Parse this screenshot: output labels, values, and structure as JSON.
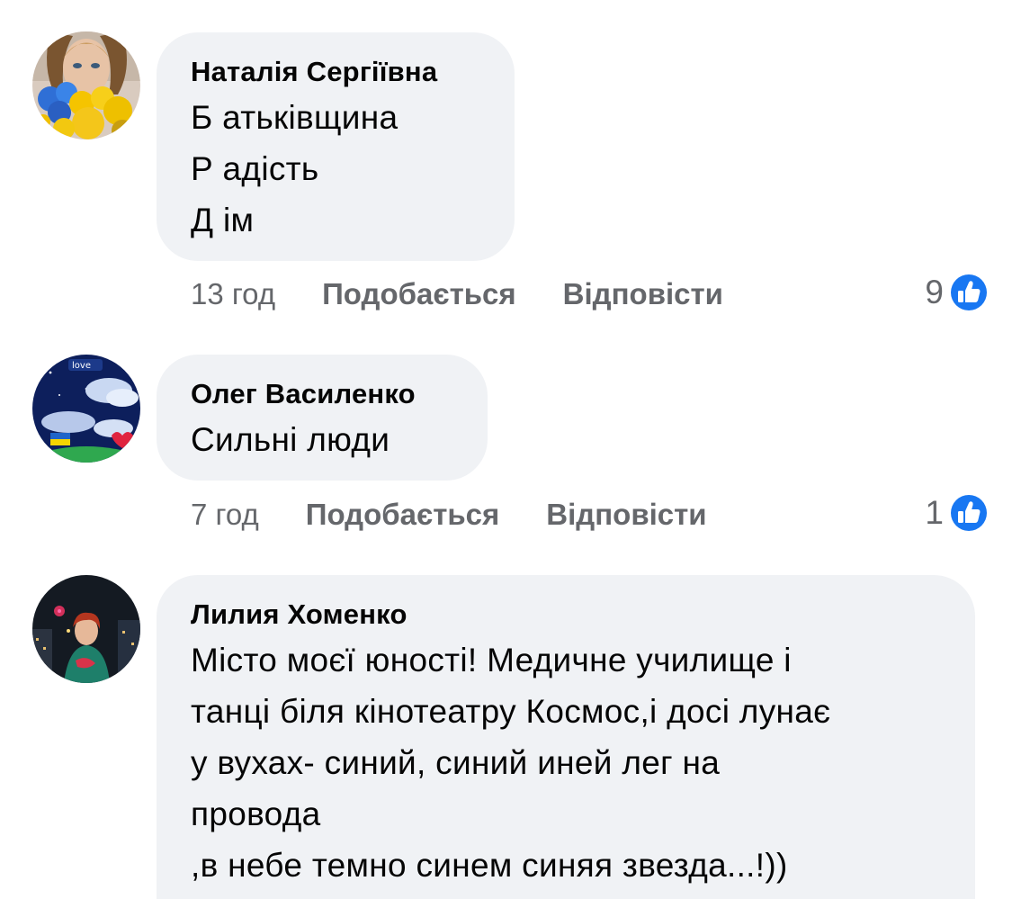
{
  "comments": [
    {
      "author": "Наталія Сергіївна",
      "lines": [
        "Б атьківщина",
        "Р адість",
        "Д ім"
      ],
      "time": "13 год",
      "like_label": "Подобається",
      "reply_label": "Відповісти",
      "reaction_count": "9"
    },
    {
      "author": "Олег Василенко",
      "lines": [
        "Сильні люди"
      ],
      "time": "7 год",
      "like_label": "Подобається",
      "reply_label": "Відповісти",
      "reaction_count": "1"
    },
    {
      "author": "Лилия Хоменко",
      "lines": [
        "Місто моєї юності! Медичне училище і",
        "танці біля кінотеатру Космос,і досі лунає",
        "у вухах- синий, синий иней лег на",
        "провода",
        ",в небе темно синем синяя звезда...!))"
      ]
    }
  ],
  "avatar_badge_text": "love",
  "colors": {
    "bubble_bg": "#f0f2f5",
    "meta_text": "#65676b",
    "like_blue": "#1877f2"
  },
  "icons": {
    "reaction": "like-thumbs-up-icon"
  }
}
